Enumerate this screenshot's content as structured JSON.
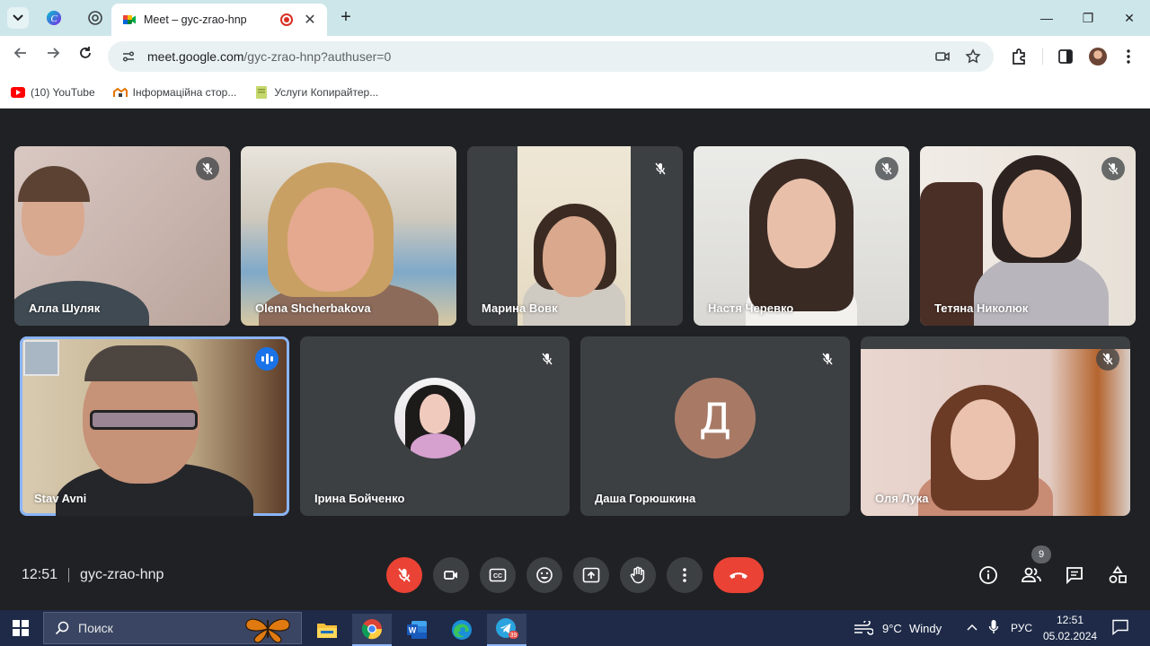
{
  "browser": {
    "tab_title": "Meet – gyc-zrao-hnp",
    "url_host": "meet.google.com",
    "url_path": "/gyc-zrao-hnp?authuser=0"
  },
  "bookmarks": [
    {
      "label": "(10) YouTube",
      "icon": "youtube-icon"
    },
    {
      "label": "Інформаційна стор...",
      "icon": "site-icon"
    },
    {
      "label": "Услуги Копирайтер...",
      "icon": "page-icon"
    }
  ],
  "participants": [
    {
      "name": "Алла Шуляк",
      "status": "muted"
    },
    {
      "name": "Olena Shcherbakova",
      "status": "unmuted"
    },
    {
      "name": "Марина Вовк",
      "status": "muted"
    },
    {
      "name": "Настя Черевко",
      "status": "muted"
    },
    {
      "name": "Тетяна Николюк",
      "status": "muted"
    },
    {
      "name": "Stav Avni",
      "status": "speaking"
    },
    {
      "name": "Ірина Бойченко",
      "status": "muted"
    },
    {
      "name": "Даша Горюшкина",
      "status": "muted",
      "avatar_letter": "Д"
    },
    {
      "name": "Оля Лука",
      "status": "muted"
    }
  ],
  "meeting": {
    "time": "12:51",
    "code": "gyc-zrao-hnp",
    "participant_count": "9"
  },
  "controls": [
    "mic-off",
    "camera",
    "captions",
    "emoji",
    "present",
    "raise-hand",
    "more-options",
    "leave-call"
  ],
  "side_controls": [
    "info",
    "people",
    "chat",
    "activities"
  ],
  "colors": {
    "meet_background": "#202124",
    "tile_background": "#3c4043",
    "danger": "#ea4335",
    "active_speaker": "#8ab4f8",
    "speaking_badge": "#1a73e8",
    "taskbar": "#1e2a48"
  },
  "taskbar": {
    "search_placeholder": "Поиск",
    "temperature": "9°C",
    "weather": "Windy",
    "language": "РУС",
    "clock_time": "12:51",
    "clock_date": "05.02.2024",
    "telegram_badge": "39"
  }
}
